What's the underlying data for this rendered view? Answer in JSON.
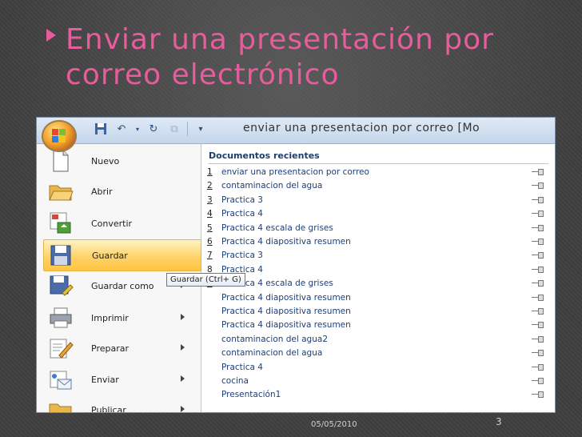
{
  "slide": {
    "title": "Enviar una presentación por correo electrónico",
    "date": "05/05/2010",
    "page_number": "3",
    "title_color": "#e75c9c"
  },
  "window": {
    "title": "enviar una presentacion por correo [Mo"
  },
  "menu": {
    "items": [
      {
        "label": "Nuevo",
        "icon": "new-document-icon",
        "arrow": false
      },
      {
        "label": "Abrir",
        "icon": "open-folder-icon",
        "arrow": false
      },
      {
        "label": "Convertir",
        "icon": "convert-icon",
        "arrow": false
      },
      {
        "label": "Guardar",
        "icon": "save-disk-icon",
        "arrow": false
      },
      {
        "label": "Guardar como",
        "icon": "save-as-icon",
        "arrow": true
      },
      {
        "label": "Imprimir",
        "icon": "printer-icon",
        "arrow": true
      },
      {
        "label": "Preparar",
        "icon": "prepare-icon",
        "arrow": true
      },
      {
        "label": "Enviar",
        "icon": "send-icon",
        "arrow": true
      },
      {
        "label": "Publicar",
        "icon": "publish-icon",
        "arrow": true
      }
    ],
    "active_index": 3,
    "tooltip": "Guardar (Ctrl+ G)"
  },
  "recent": {
    "header": "Documentos recientes",
    "items": [
      {
        "num": "1",
        "name": "enviar una presentacion por correo"
      },
      {
        "num": "2",
        "name": "contaminacion del agua"
      },
      {
        "num": "3",
        "name": "Practica 3"
      },
      {
        "num": "4",
        "name": "Practica 4"
      },
      {
        "num": "5",
        "name": "Practica 4 escala de grises"
      },
      {
        "num": "6",
        "name": "Practica 4 diapositiva resumen"
      },
      {
        "num": "7",
        "name": "Practica 3"
      },
      {
        "num": "8",
        "name": "Practica 4"
      },
      {
        "num": "9",
        "name": "Practica 4 escala de grises"
      },
      {
        "num": "",
        "name": "Practica 4 diapositiva resumen"
      },
      {
        "num": "",
        "name": "Practica 4 diapositiva resumen"
      },
      {
        "num": "",
        "name": "Practica 4 diapositiva resumen"
      },
      {
        "num": "",
        "name": "contaminacion del agua2"
      },
      {
        "num": "",
        "name": "contaminacion del agua"
      },
      {
        "num": "",
        "name": "Practica 4"
      },
      {
        "num": "",
        "name": "cocina"
      },
      {
        "num": "",
        "name": "Presentación1"
      }
    ]
  }
}
